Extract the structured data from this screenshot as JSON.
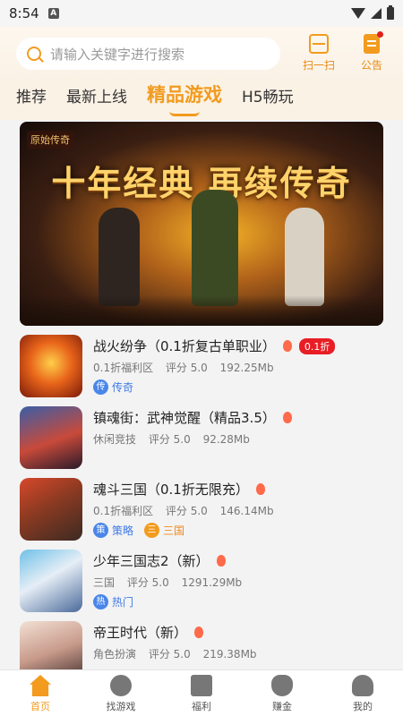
{
  "status_bar": {
    "time": "8:54",
    "app_indicator": "A"
  },
  "search": {
    "placeholder": "请输入关键字进行搜索"
  },
  "header_actions": {
    "scan_label": "扫一扫",
    "notice_label": "公告"
  },
  "tabs": [
    {
      "label": "推荐"
    },
    {
      "label": "最新上线"
    },
    {
      "label": "精品游戏",
      "active": true
    },
    {
      "label": "H5畅玩"
    }
  ],
  "banner": {
    "logo_text": "原始传奇",
    "title": "十年经典 再续传奇"
  },
  "games": [
    {
      "name": "战火纷争（0.1折复古单职业）",
      "badge": "0.1折",
      "category": "0.1折福利区",
      "rating": "评分 5.0",
      "size": "192.25Mb",
      "tags": [
        {
          "icon": "传",
          "label": "传奇"
        }
      ]
    },
    {
      "name": "镇魂街：武神觉醒（精品3.5）",
      "category": "休闲竞技",
      "rating": "评分 5.0",
      "size": "92.28Mb"
    },
    {
      "name": "魂斗三国（0.1折无限充）",
      "category": "0.1折福利区",
      "rating": "评分 5.0",
      "size": "146.14Mb",
      "tags": [
        {
          "icon": "策",
          "label": "策略"
        },
        {
          "icon": "三",
          "label": "三国"
        }
      ]
    },
    {
      "name": "少年三国志2（新）",
      "category": "三国",
      "rating": "评分 5.0",
      "size": "1291.29Mb",
      "tags": [
        {
          "icon": "热",
          "label": "热门"
        }
      ]
    },
    {
      "name": "帝王时代（新）",
      "category": "角色扮演",
      "rating": "评分 5.0",
      "size": "219.38Mb"
    }
  ],
  "bottom_nav": [
    {
      "label": "首页",
      "icon": "home-icon",
      "active": true
    },
    {
      "label": "找游戏",
      "icon": "compass-icon"
    },
    {
      "label": "福利",
      "icon": "gift-icon"
    },
    {
      "label": "赚金",
      "icon": "money-icon"
    },
    {
      "label": "我的",
      "icon": "profile-icon"
    }
  ],
  "colors": {
    "accent": "#f29b1e",
    "badge_red": "#e81e25",
    "tag_blue": "#4a86ea"
  }
}
